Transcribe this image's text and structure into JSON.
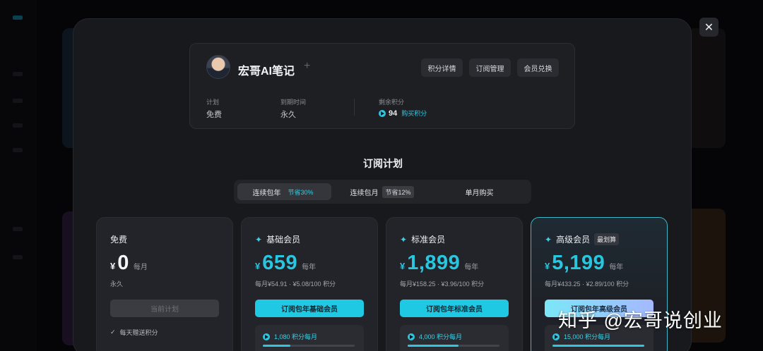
{
  "profile": {
    "name": "宏哥AI笔记",
    "buttons": [
      "积分详情",
      "订阅管理",
      "会员兑换"
    ],
    "plan_label": "计划",
    "plan_value": "免费",
    "expiry_label": "到期时间",
    "expiry_value": "永久",
    "points_label": "剩余积分",
    "points_value": "94",
    "buy_points": "购买积分"
  },
  "section_title": "订阅计划",
  "tabs": [
    {
      "label": "连续包年",
      "badge": "节省30%",
      "active": true
    },
    {
      "label": "连续包月",
      "badge": "节省12%",
      "active": false
    },
    {
      "label": "单月购买",
      "badge": "",
      "active": false
    }
  ],
  "plans": [
    {
      "name": "免费",
      "currency": "¥",
      "price": "0",
      "period": "每月",
      "sub": "永久",
      "button": "当前计划",
      "perk": "每天赠送积分"
    },
    {
      "name": "基础会员",
      "currency": "¥",
      "price": "659",
      "period": "每年",
      "sub": "每月¥54.91 · ¥5.08/100 积分",
      "button": "订阅包年基础会员",
      "points": "1,080 积分每月",
      "points_level": 0.3
    },
    {
      "name": "标准会员",
      "currency": "¥",
      "price": "1,899",
      "period": "每年",
      "sub": "每月¥158.25 · ¥3.96/100 积分",
      "button": "订阅包年标准会员",
      "points": "4,000 积分每月",
      "points_level": 0.55
    },
    {
      "name": "高级会员",
      "badge": "最划算",
      "currency": "¥",
      "price": "5,199",
      "period": "每年",
      "sub": "每月¥433.25 · ¥2.89/100 积分",
      "button": "订阅包年高级会员",
      "points": "15,000 积分每月",
      "points_level": 1.0
    }
  ],
  "close_icon": "close-icon",
  "watermark": "知乎 @宏哥说创业",
  "colors": {
    "accent": "#1fc9e3",
    "modal_bg": "#18191d",
    "card_bg": "#22242a"
  }
}
